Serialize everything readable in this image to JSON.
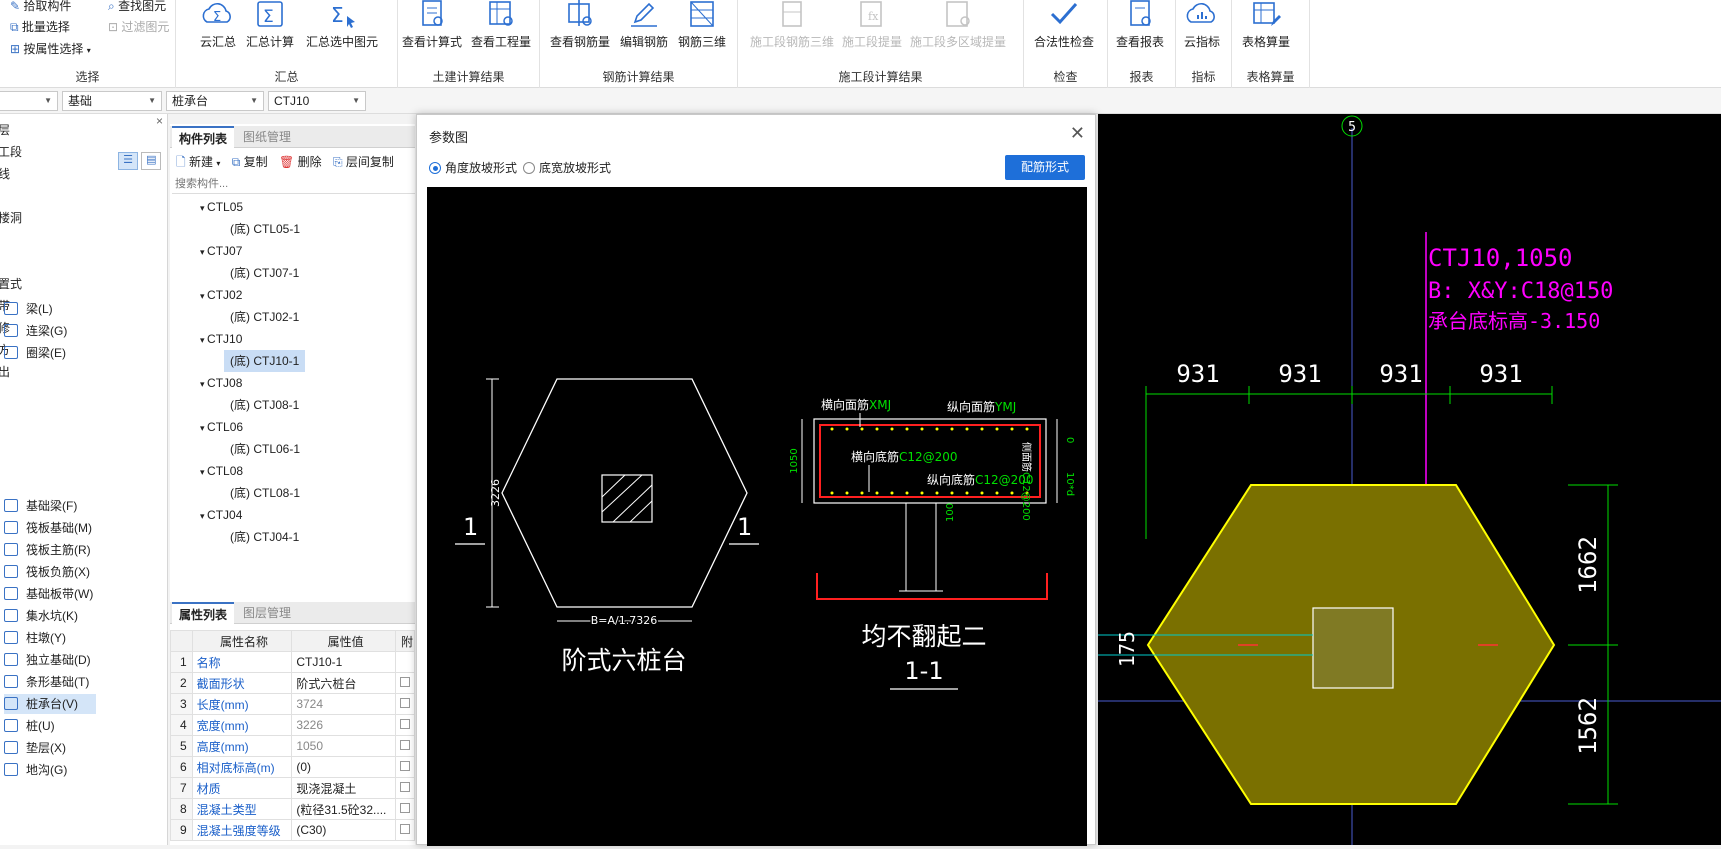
{
  "ribbon": {
    "select_group": {
      "label": "选择",
      "items": [
        "拾取构件",
        "批量选择",
        "按属性选择",
        "查找图元",
        "过滤图元"
      ]
    },
    "summary_group": {
      "label": "汇总",
      "buttons": [
        "云汇总",
        "汇总计算",
        "汇总选中图元"
      ]
    },
    "civil_group": {
      "label": "土建计算结果",
      "buttons": [
        "查看计算式",
        "查看工程量"
      ]
    },
    "rebar_group": {
      "label": "钢筋计算结果",
      "buttons": [
        "查看钢筋量",
        "编辑钢筋",
        "钢筋三维"
      ]
    },
    "stage_group": {
      "label": "施工段计算结果",
      "buttons": [
        "施工段钢筋三维",
        "施工段提量",
        "施工段多区域提量"
      ]
    },
    "check_group": {
      "label": "检查",
      "buttons": [
        "合法性检查"
      ]
    },
    "report_group": {
      "label": "报表",
      "buttons": [
        "查看报表"
      ]
    },
    "index_group": {
      "label": "指标",
      "buttons": [
        "云指标"
      ]
    },
    "table_group": {
      "label": "表格算量",
      "buttons": [
        "表格算量"
      ]
    }
  },
  "dropdowns": [
    "",
    "基础",
    "桩承台",
    "CTJ10"
  ],
  "left_panel": {
    "partial_items": [
      "层",
      "工段",
      "线",
      "",
      "楼洞",
      "",
      "",
      "置式",
      "带",
      "修",
      "方",
      "出"
    ],
    "items": [
      {
        "label": "梁(L)",
        "icon": "beam-icon"
      },
      {
        "label": "连梁(G)",
        "icon": "link-beam-icon"
      },
      {
        "label": "圈梁(E)",
        "icon": "ring-beam-icon"
      },
      {
        "label": "基础梁(F)",
        "icon": "foundation-beam-icon"
      },
      {
        "label": "筏板基础(M)",
        "icon": "raft-icon"
      },
      {
        "label": "筏板主筋(R)",
        "icon": "raft-rebar-icon"
      },
      {
        "label": "筏板负筋(X)",
        "icon": "raft-neg-rebar-icon"
      },
      {
        "label": "基础板带(W)",
        "icon": "strip-icon"
      },
      {
        "label": "集水坑(K)",
        "icon": "sump-icon"
      },
      {
        "label": "柱墩(Y)",
        "icon": "pier-icon"
      },
      {
        "label": "独立基础(D)",
        "icon": "isolated-footing-icon"
      },
      {
        "label": "条形基础(T)",
        "icon": "strip-footing-icon"
      },
      {
        "label": "桩承台(V)",
        "icon": "pile-cap-icon",
        "selected": true
      },
      {
        "label": "桩(U)",
        "icon": "pile-icon"
      },
      {
        "label": "垫层(X)",
        "icon": "cushion-icon"
      },
      {
        "label": "地沟(G)",
        "icon": "trench-icon"
      }
    ]
  },
  "component_list": {
    "tabs": [
      "构件列表",
      "图纸管理"
    ],
    "toolbar": [
      "新建",
      "复制",
      "删除",
      "层间复制"
    ],
    "search_placeholder": "搜索构件...",
    "tree": [
      {
        "name": "CTL05",
        "child": "(底) CTL05-1"
      },
      {
        "name": "CTJ07",
        "child": "(底) CTJ07-1"
      },
      {
        "name": "CTJ02",
        "child": "(底) CTJ02-1"
      },
      {
        "name": "CTJ10",
        "child": "(底) CTJ10-1",
        "selected": true
      },
      {
        "name": "CTJ08",
        "child": "(底) CTJ08-1"
      },
      {
        "name": "CTL06",
        "child": "(底) CTL06-1"
      },
      {
        "name": "CTL08",
        "child": "(底) CTL08-1"
      },
      {
        "name": "CTJ04",
        "child": "(底) CTJ04-1"
      }
    ]
  },
  "properties": {
    "tabs": [
      "属性列表",
      "图层管理"
    ],
    "headers": [
      "属性名称",
      "属性值",
      "附"
    ],
    "rows": [
      {
        "n": "1",
        "name": "名称",
        "value": "CTJ10-1",
        "grey": false
      },
      {
        "n": "2",
        "name": "截面形状",
        "value": "阶式六桩台",
        "grey": false
      },
      {
        "n": "3",
        "name": "长度(mm)",
        "value": "3724",
        "grey": true
      },
      {
        "n": "4",
        "name": "宽度(mm)",
        "value": "3226",
        "grey": true
      },
      {
        "n": "5",
        "name": "高度(mm)",
        "value": "1050",
        "grey": true
      },
      {
        "n": "6",
        "name": "相对底标高(m)",
        "value": "(0)",
        "grey": false
      },
      {
        "n": "7",
        "name": "材质",
        "value": "现浇混凝土",
        "grey": false
      },
      {
        "n": "8",
        "name": "混凝土类型",
        "value": "(粒径31.5砼32....",
        "grey": false
      },
      {
        "n": "9",
        "name": "混凝土强度等级",
        "value": "(C30)",
        "grey": false
      }
    ]
  },
  "dialog": {
    "title": "参数图",
    "radio_angle": "角度放坡形式",
    "radio_width": "底宽放坡形式",
    "button": "配筋形式",
    "drawing": {
      "hex_height_dim": "3226",
      "hex_width_dim": "B=A/1.7326",
      "section_mark": "1",
      "hex_caption": "阶式六桩台",
      "section_title": "均不翻起二",
      "section_name": "1-1",
      "height_dim": "1050",
      "top_bar_x": "横向面筋",
      "top_bar_x_val": "XMJ",
      "top_bar_y": "纵向面筋",
      "top_bar_y_val": "YMJ",
      "bottom_bar_x": "横向底筋",
      "bottom_bar_x_val": "C12@200",
      "bottom_bar_y": "纵向底筋",
      "bottom_bar_y_val": "C12@200",
      "side_bar": "侧面筋",
      "side_bar_val": "C12@200",
      "side_dim_top": "0",
      "side_dim_mid": "10*d",
      "cover_dim": "100"
    }
  },
  "cad": {
    "axis_label": "5",
    "annotation_name": "CTJ10,1050",
    "annotation_rebar": "B: X&Y:C18@150",
    "annotation_elev": "承台底标高-3.150",
    "top_dims": [
      "931",
      "931",
      "931",
      "931"
    ],
    "right_dims": [
      "1662",
      "1562"
    ],
    "left_dim": "175",
    "colors": {
      "hex_fill": "#7a7000",
      "hex_stroke": "#ffff00",
      "dim": "#00dd00",
      "annotation": "#ff00ff"
    }
  }
}
